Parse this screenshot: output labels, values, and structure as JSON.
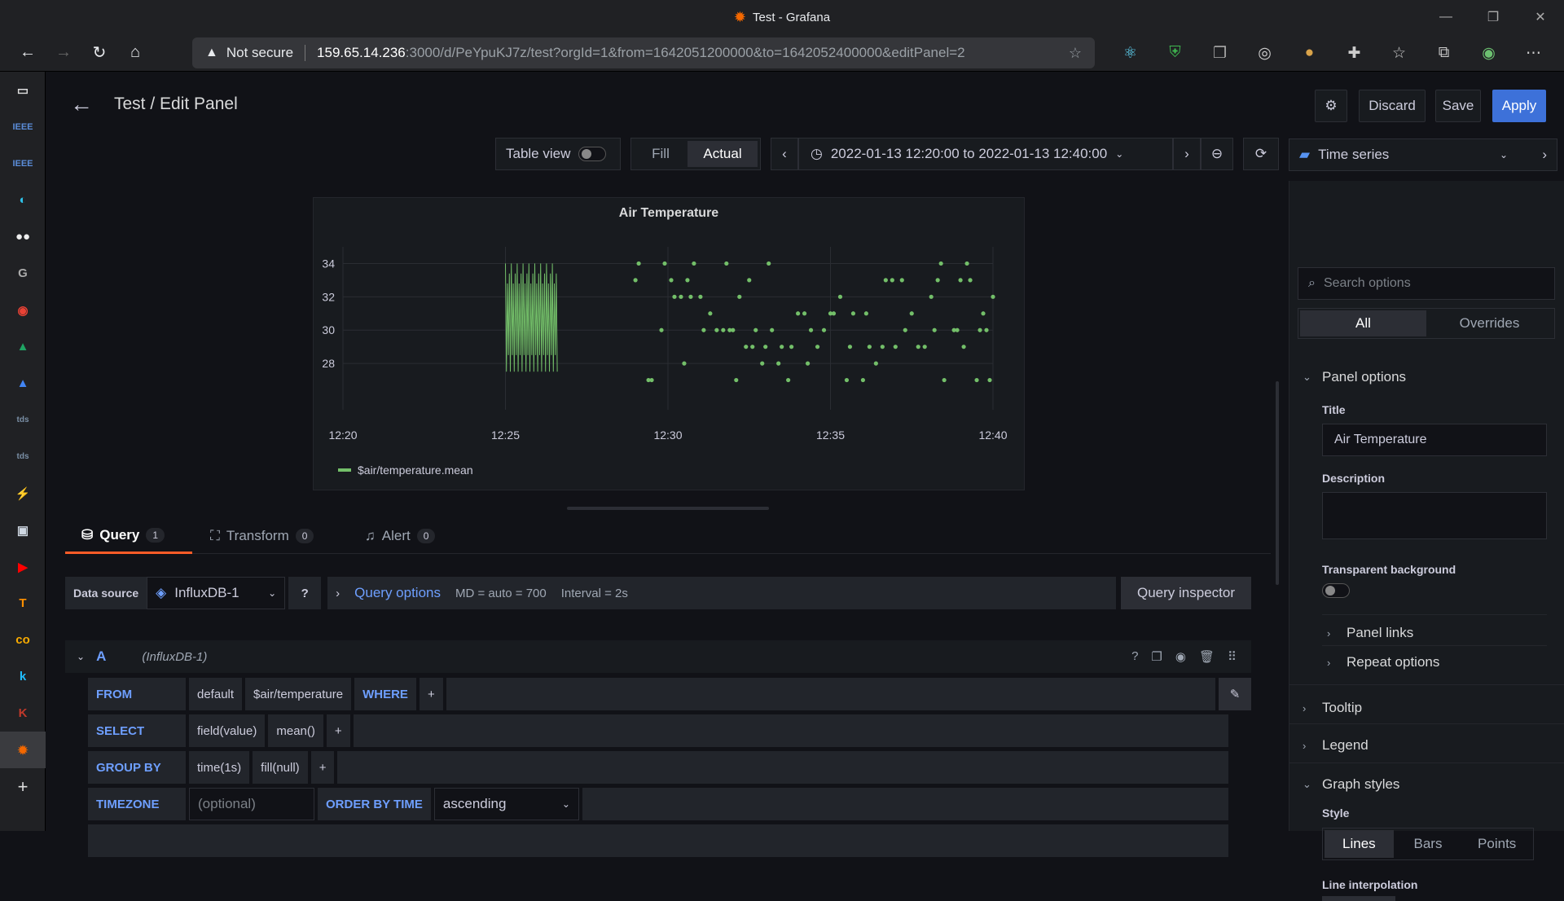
{
  "browser": {
    "window_title": "Test - Grafana",
    "security": "Not secure",
    "url_host": "159.65.14.236",
    "url_path": ":3000/d/PeYpuKJ7z/test?orgId=1&from=1642051200000&to=1642052400000&editPanel=2"
  },
  "header": {
    "title": "Test / Edit Panel",
    "discard": "Discard",
    "save": "Save",
    "apply": "Apply"
  },
  "toolbar": {
    "table_view": "Table view",
    "fill": "Fill",
    "actual": "Actual",
    "time_range": "2022-01-13 12:20:00 to 2022-01-13 12:40:00",
    "viz_type": "Time series"
  },
  "chart_data": {
    "type": "scatter",
    "title": "Air Temperature",
    "x_ticks": [
      "12:20",
      "12:25",
      "12:30",
      "12:35",
      "12:40"
    ],
    "y_ticks": [
      "34",
      "32",
      "30",
      "28"
    ],
    "ylim": [
      26,
      35
    ],
    "series": [
      {
        "name": "$air/temperature.mean",
        "color": "#73bf69"
      }
    ],
    "legend_placement": "bottom-left",
    "grid": true,
    "dense_segment": {
      "x_start": "12:25",
      "x_end": "12:26:36",
      "y_min": 27,
      "y_max": 34
    },
    "points": [
      [
        "12:29:00",
        33
      ],
      [
        "12:29:06",
        34
      ],
      [
        "12:29:24",
        27
      ],
      [
        "12:29:30",
        27
      ],
      [
        "12:29:48",
        30
      ],
      [
        "12:29:54",
        34
      ],
      [
        "12:30:06",
        33
      ],
      [
        "12:30:12",
        32
      ],
      [
        "12:30:24",
        32
      ],
      [
        "12:30:30",
        28
      ],
      [
        "12:30:36",
        33
      ],
      [
        "12:30:42",
        32
      ],
      [
        "12:30:48",
        34
      ],
      [
        "12:31:00",
        32
      ],
      [
        "12:31:06",
        30
      ],
      [
        "12:31:18",
        31
      ],
      [
        "12:31:30",
        30
      ],
      [
        "12:31:42",
        30
      ],
      [
        "12:31:48",
        34
      ],
      [
        "12:31:54",
        30
      ],
      [
        "12:32:00",
        30
      ],
      [
        "12:32:06",
        27
      ],
      [
        "12:32:12",
        32
      ],
      [
        "12:32:24",
        29
      ],
      [
        "12:32:30",
        33
      ],
      [
        "12:32:36",
        29
      ],
      [
        "12:32:42",
        30
      ],
      [
        "12:32:54",
        28
      ],
      [
        "12:33:00",
        29
      ],
      [
        "12:33:06",
        34
      ],
      [
        "12:33:12",
        30
      ],
      [
        "12:33:24",
        28
      ],
      [
        "12:33:30",
        29
      ],
      [
        "12:33:42",
        27
      ],
      [
        "12:33:48",
        29
      ],
      [
        "12:34:00",
        31
      ],
      [
        "12:34:12",
        31
      ],
      [
        "12:34:18",
        28
      ],
      [
        "12:34:24",
        30
      ],
      [
        "12:34:36",
        29
      ],
      [
        "12:34:48",
        30
      ],
      [
        "12:35:00",
        31
      ],
      [
        "12:35:06",
        31
      ],
      [
        "12:35:18",
        32
      ],
      [
        "12:35:30",
        27
      ],
      [
        "12:35:36",
        29
      ],
      [
        "12:35:42",
        31
      ],
      [
        "12:36:00",
        27
      ],
      [
        "12:36:06",
        31
      ],
      [
        "12:36:12",
        29
      ],
      [
        "12:36:24",
        28
      ],
      [
        "12:36:36",
        29
      ],
      [
        "12:36:42",
        33
      ],
      [
        "12:36:54",
        33
      ],
      [
        "12:37:00",
        29
      ],
      [
        "12:37:12",
        33
      ],
      [
        "12:37:18",
        30
      ],
      [
        "12:37:30",
        31
      ],
      [
        "12:37:42",
        29
      ],
      [
        "12:37:54",
        29
      ],
      [
        "12:38:06",
        32
      ],
      [
        "12:38:12",
        30
      ],
      [
        "12:38:18",
        33
      ],
      [
        "12:38:24",
        34
      ],
      [
        "12:38:30",
        27
      ],
      [
        "12:38:48",
        30
      ],
      [
        "12:38:54",
        30
      ],
      [
        "12:39:00",
        33
      ],
      [
        "12:39:06",
        29
      ],
      [
        "12:39:12",
        34
      ],
      [
        "12:39:18",
        33
      ],
      [
        "12:39:30",
        27
      ],
      [
        "12:39:42",
        31
      ],
      [
        "12:39:48",
        30
      ],
      [
        "12:39:54",
        27
      ],
      [
        "12:40:00",
        32
      ],
      [
        "12:39:36",
        30
      ]
    ]
  },
  "tabs": [
    {
      "label": "Query",
      "count": "1"
    },
    {
      "label": "Transform",
      "count": "0"
    },
    {
      "label": "Alert",
      "count": "0"
    }
  ],
  "query": {
    "data_source_label": "Data source",
    "data_source": "InfluxDB-1",
    "query_options": "Query options",
    "md": "MD = auto = 700",
    "interval": "Interval = 2s",
    "inspector": "Query inspector",
    "ref_id": "A",
    "ref_ds": "(InfluxDB-1)",
    "from_kw": "FROM",
    "from_policy": "default",
    "from_measurement": "$air/temperature",
    "where_kw": "WHERE",
    "select_kw": "SELECT",
    "select_field": "field(value)",
    "select_fn": "mean()",
    "group_kw": "GROUP BY",
    "group_time": "time(1s)",
    "group_fill": "fill(null)",
    "tz_kw": "TIMEZONE",
    "tz_placeholder": "(optional)",
    "order_kw": "ORDER BY TIME",
    "order_val": "ascending",
    "plus": "+"
  },
  "options": {
    "search_placeholder": "Search options",
    "all": "All",
    "overrides": "Overrides",
    "panel_options": "Panel options",
    "title_label": "Title",
    "title_value": "Air Temperature",
    "description_label": "Description",
    "transparent_label": "Transparent background",
    "panel_links": "Panel links",
    "repeat_options": "Repeat options",
    "tooltip": "Tooltip",
    "legend": "Legend",
    "graph_styles": "Graph styles",
    "style_label": "Style",
    "style_lines": "Lines",
    "style_bars": "Bars",
    "style_points": "Points",
    "line_interp": "Line interpolation"
  }
}
